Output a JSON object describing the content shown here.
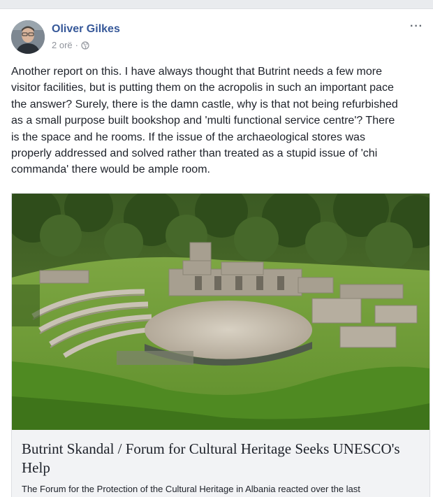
{
  "post": {
    "author": "Oliver Gilkes",
    "time": "2 orë",
    "separator": "·",
    "more": "···",
    "text": "Another report on this. I have always thought that Butrint needs a few more\nvisitor facilities, but is putting them on the acropolis in such an important pace\nthe answer? Surely, there is the damn castle, why is that not being refurbished\nas a small purpose built bookshop and 'multi functional service centre'? There\nis the space and he rooms. If the issue of the archaeological stores was\nproperly addressed and solved rather than treated as a stupid issue of 'chi\ncommanda' there would be ample room.",
    "privacy_icon": "globe-icon"
  },
  "link": {
    "title": "Butrint Skandal / Forum for Cultural Heritage Seeks UNESCO's Help",
    "description": "The Forum for the Protection of the Cultural Heritage in Albania reacted over the last\nconstruction scandal in the Archaeological Park of Butrint, near a prehistoric wall"
  },
  "colors": {
    "author": "#365899",
    "meta": "#90949c",
    "card_bg": "#f2f3f5"
  }
}
